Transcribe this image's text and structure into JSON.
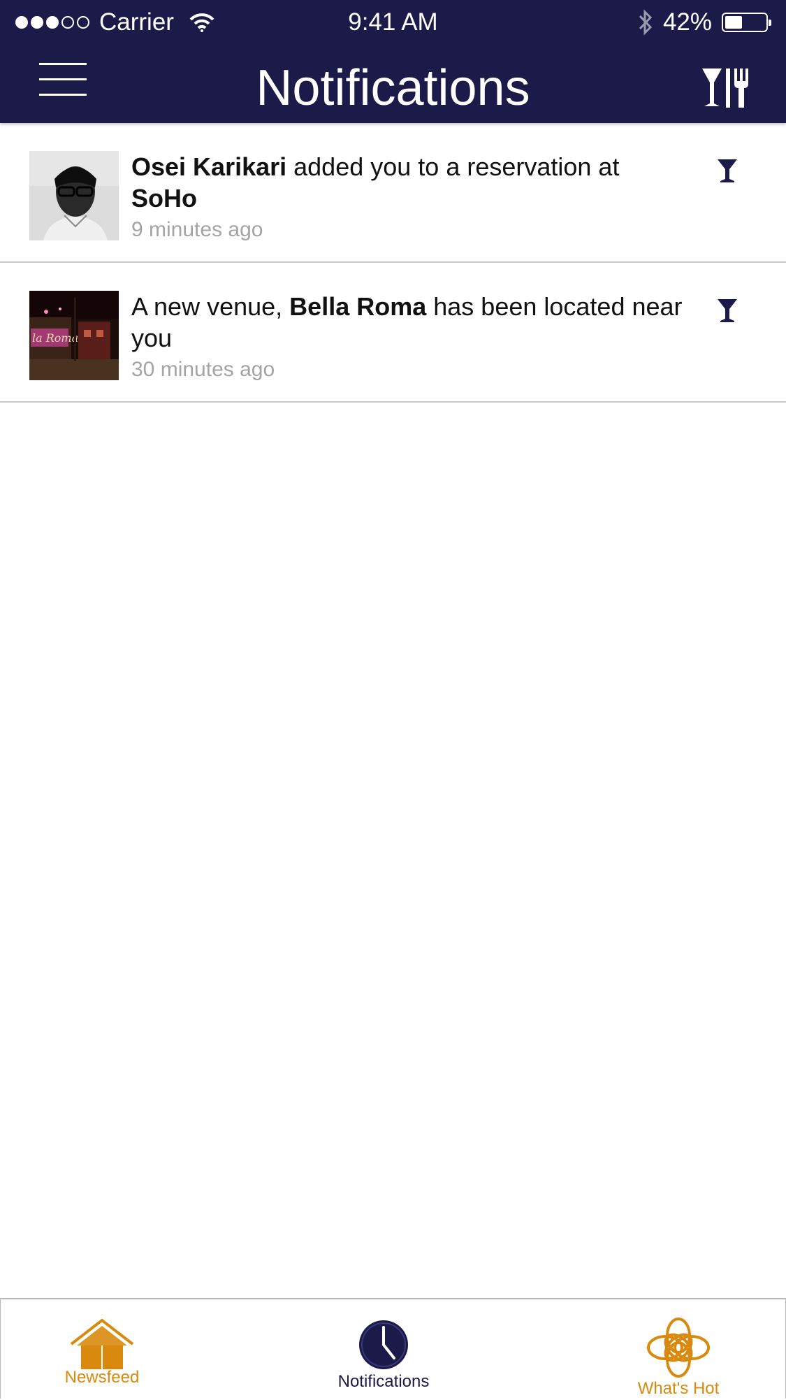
{
  "status_bar": {
    "carrier": "Carrier",
    "time": "9:41 AM",
    "battery_percent": "42%",
    "battery_level": 0.42,
    "signal_dots_filled": 3,
    "signal_dots_total": 5
  },
  "header": {
    "title": "Notifications",
    "left_icon": "menu-icon",
    "right_icon": "glass-fork-icon"
  },
  "notifications": [
    {
      "pre": "",
      "bold1": "Osei Karikari",
      "mid": " added you to a reservation at ",
      "bold2": "SoHo",
      "post": "",
      "time": "9 minutes ago",
      "icon": "cocktail-icon"
    },
    {
      "pre": "A new venue, ",
      "bold1": "Bella Roma",
      "mid": " has been located near you",
      "bold2": "",
      "post": "",
      "time": "30 minutes ago",
      "icon": "cocktail-icon"
    }
  ],
  "tabs": {
    "newsfeed": "Newsfeed",
    "notifications": "Notifications",
    "whats_hot": "What's Hot"
  },
  "colors": {
    "header_bg": "#1c1a48",
    "accent_orange": "#d98a0e",
    "active_tab": "#1c1a48"
  }
}
